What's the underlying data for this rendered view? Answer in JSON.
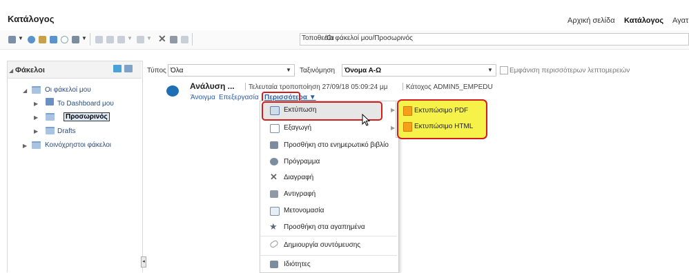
{
  "header": {
    "title": "Κατάλογος",
    "links": [
      "Αρχική σελίδα",
      "Κατάλογος",
      "Αγατ"
    ]
  },
  "toolbar": {
    "location_label": "Τοποθεσία",
    "location_value": "/Οι φάκελοί μου/Προσωρινός",
    "icons": [
      "view-icon",
      "refresh-icon",
      "folder-up-icon",
      "new-folder-icon",
      "search-icon",
      "layout-icon",
      "edit-icon",
      "pencil-icon",
      "print-icon",
      "export-icon",
      "delete-icon",
      "copy-icon",
      "paste-icon"
    ]
  },
  "left_pane": {
    "title": "Φάκελοι",
    "tree": [
      {
        "label": "Οι φάκελοί μου",
        "expanded": true
      },
      {
        "label": "Το Dashboard μου"
      },
      {
        "label": "Προσωρινός",
        "selected": true
      },
      {
        "label": "Drafts"
      },
      {
        "label": "Κοινόχρηστοι φάκελοι"
      }
    ]
  },
  "filter": {
    "type_label": "Τύπος",
    "type_value": "Όλα",
    "sort_label": "Ταξινόμηση",
    "sort_value": "Όνομα Α-Ω",
    "details_label": "Εμφάνιση περισσότερων λεπτομερειών"
  },
  "item": {
    "title": "Ανάλυση ...",
    "modified": "Τελευταία τροποποίηση 27/09/18 05:09:24 μμ",
    "owner": "Κάτοχος ADMIN5_EMPEDU",
    "open": "Άνοιγμα",
    "edit": "Επεξεργασία",
    "more": "Περισσότερα ▼"
  },
  "menu": [
    {
      "label": "Εκτύπωση",
      "icon": "print-icon",
      "submenu": true
    },
    {
      "label": "Εξαγωγή",
      "icon": "export-icon",
      "submenu": true
    },
    {
      "label": "Προσθήκη στο ενημερωτικό βιβλίο",
      "icon": "briefing-book-icon"
    },
    {
      "label": "Πρόγραμμα",
      "icon": "schedule-icon"
    },
    {
      "label": "Διαγραφή",
      "icon": "delete-icon"
    },
    {
      "label": "Αντιγραφή",
      "icon": "copy-icon"
    },
    {
      "label": "Μετονομασία",
      "icon": "rename-icon"
    },
    {
      "label": "Προσθήκη στα αγαπημένα",
      "icon": "favorite-icon"
    },
    {
      "label": "Δημιουργία συντόμευσης",
      "icon": "shortcut-icon"
    },
    {
      "label": "Ιδιότητες",
      "icon": "properties-icon"
    }
  ],
  "submenu": [
    {
      "label": "Εκτυπώσιμο PDF",
      "icon": "pdf-icon"
    },
    {
      "label": "Εκτυπώσιμο HTML",
      "icon": "html-icon"
    }
  ],
  "colors": {
    "highlight_red": "#d21d1d",
    "highlight_yellow": "#f6f24a",
    "link": "#2a5da8"
  }
}
